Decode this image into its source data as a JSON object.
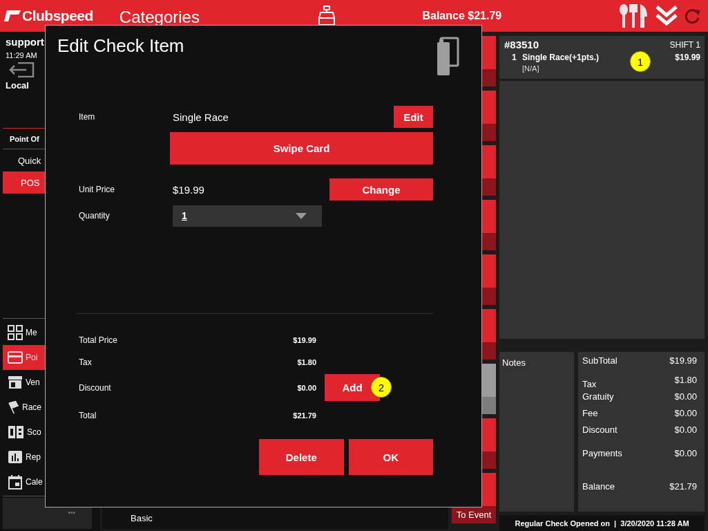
{
  "header": {
    "logo": "Clubspeed",
    "title": "Categories",
    "balance": "Balance $21.79"
  },
  "sidebar": {
    "user": "support",
    "time": "11:29 AM",
    "location": "Local",
    "section": "Point Of",
    "modes": [
      {
        "label": "Quick",
        "selected": false
      },
      {
        "label": "POS",
        "selected": true
      }
    ],
    "nav": [
      {
        "label": "Me",
        "selected": false
      },
      {
        "label": "Poi",
        "selected": true
      },
      {
        "label": "Ven",
        "selected": false
      },
      {
        "label": "Race",
        "selected": false
      },
      {
        "label": "Sco",
        "selected": false
      },
      {
        "label": "Rep",
        "selected": false
      },
      {
        "label": "Cale",
        "selected": false
      }
    ],
    "more": "•••"
  },
  "category_bar": {
    "label": "Basic"
  },
  "action_column": {
    "last_button": "To Event"
  },
  "check": {
    "number": "#83510",
    "shift": "SHIFT 1",
    "items": [
      {
        "qty": "1",
        "name": "Single Race(+1pts.)",
        "detail": "[N/A]",
        "price": "$19.99",
        "badge": "1"
      }
    ],
    "notes_label": "Notes",
    "totals": [
      {
        "label": "SubTotal",
        "value": "$19.99"
      },
      {
        "label": "Tax",
        "value": "$1.80"
      },
      {
        "label": "Gratuity",
        "value": "$0.00"
      },
      {
        "label": "Fee",
        "value": "$0.00"
      },
      {
        "label": "Discount",
        "value": "$0.00"
      },
      {
        "label": "Payments",
        "value": "$0.00"
      },
      {
        "label": "Balance",
        "value": "$21.79"
      }
    ],
    "status": "Regular Check Opened on  |  3/20/2020 11:28 AM"
  },
  "dialog": {
    "title": "Edit Check Item",
    "item_label": "Item",
    "item_value": "Single Race",
    "edit_button": "Edit",
    "swipe_button": "Swipe Card",
    "unit_price_label": "Unit Price",
    "unit_price": "$19.99",
    "change_button": "Change",
    "quantity_label": "Quantity",
    "quantity": "1",
    "summary": [
      {
        "label": "Total Price",
        "value": "$19.99"
      },
      {
        "label": "Tax",
        "value": "$1.80"
      },
      {
        "label": "Discount",
        "value": "$0.00",
        "action": "Add",
        "badge": "2"
      },
      {
        "label": "Total",
        "value": "$21.79"
      }
    ],
    "buttons": [
      "Delete",
      "OK"
    ]
  }
}
